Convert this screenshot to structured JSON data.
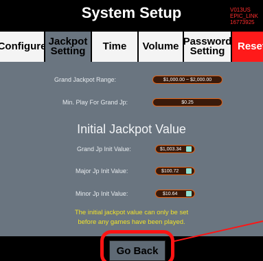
{
  "header": {
    "title": "System Setup",
    "version_lines": [
      "V013US",
      "EPIC_LINK",
      "16773925"
    ]
  },
  "tabs": [
    {
      "label_line1": "Configure",
      "label_line2": ""
    },
    {
      "label_line1": "Jackpot",
      "label_line2": "Setting"
    },
    {
      "label_line1": "Time",
      "label_line2": ""
    },
    {
      "label_line1": "Volume",
      "label_line2": ""
    },
    {
      "label_line1": "Password",
      "label_line2": "Setting"
    },
    {
      "label_line1": "Reset",
      "label_line2": ""
    }
  ],
  "jackpot": {
    "grand_range_label": "Grand Jackpot Range:",
    "grand_range_value": "$1,000.00 ~ $2,000.00",
    "min_play_label": "Min. Play For Grand Jp:",
    "min_play_value": "$0.25",
    "section_title": "Initial Jackpot Value",
    "grand_init_label": "Grand Jp Init Value:",
    "grand_init_value": "$1,003.34",
    "major_init_label": "Major Jp Init Value:",
    "major_init_value": "$100.72",
    "minor_init_label": "Minor Jp Init Value:",
    "minor_init_value": "$10.64",
    "note_line1": "The initial jackpot value can only be set",
    "note_line2": "before any games have been played."
  },
  "footer": {
    "go_back_label": "Go Back"
  },
  "colors": {
    "active_tab": "#6a7580",
    "reset_tab": "#ff1a1a",
    "field_border": "#e0641a",
    "note": "#f0e22a",
    "annotation": "#ff1414"
  }
}
